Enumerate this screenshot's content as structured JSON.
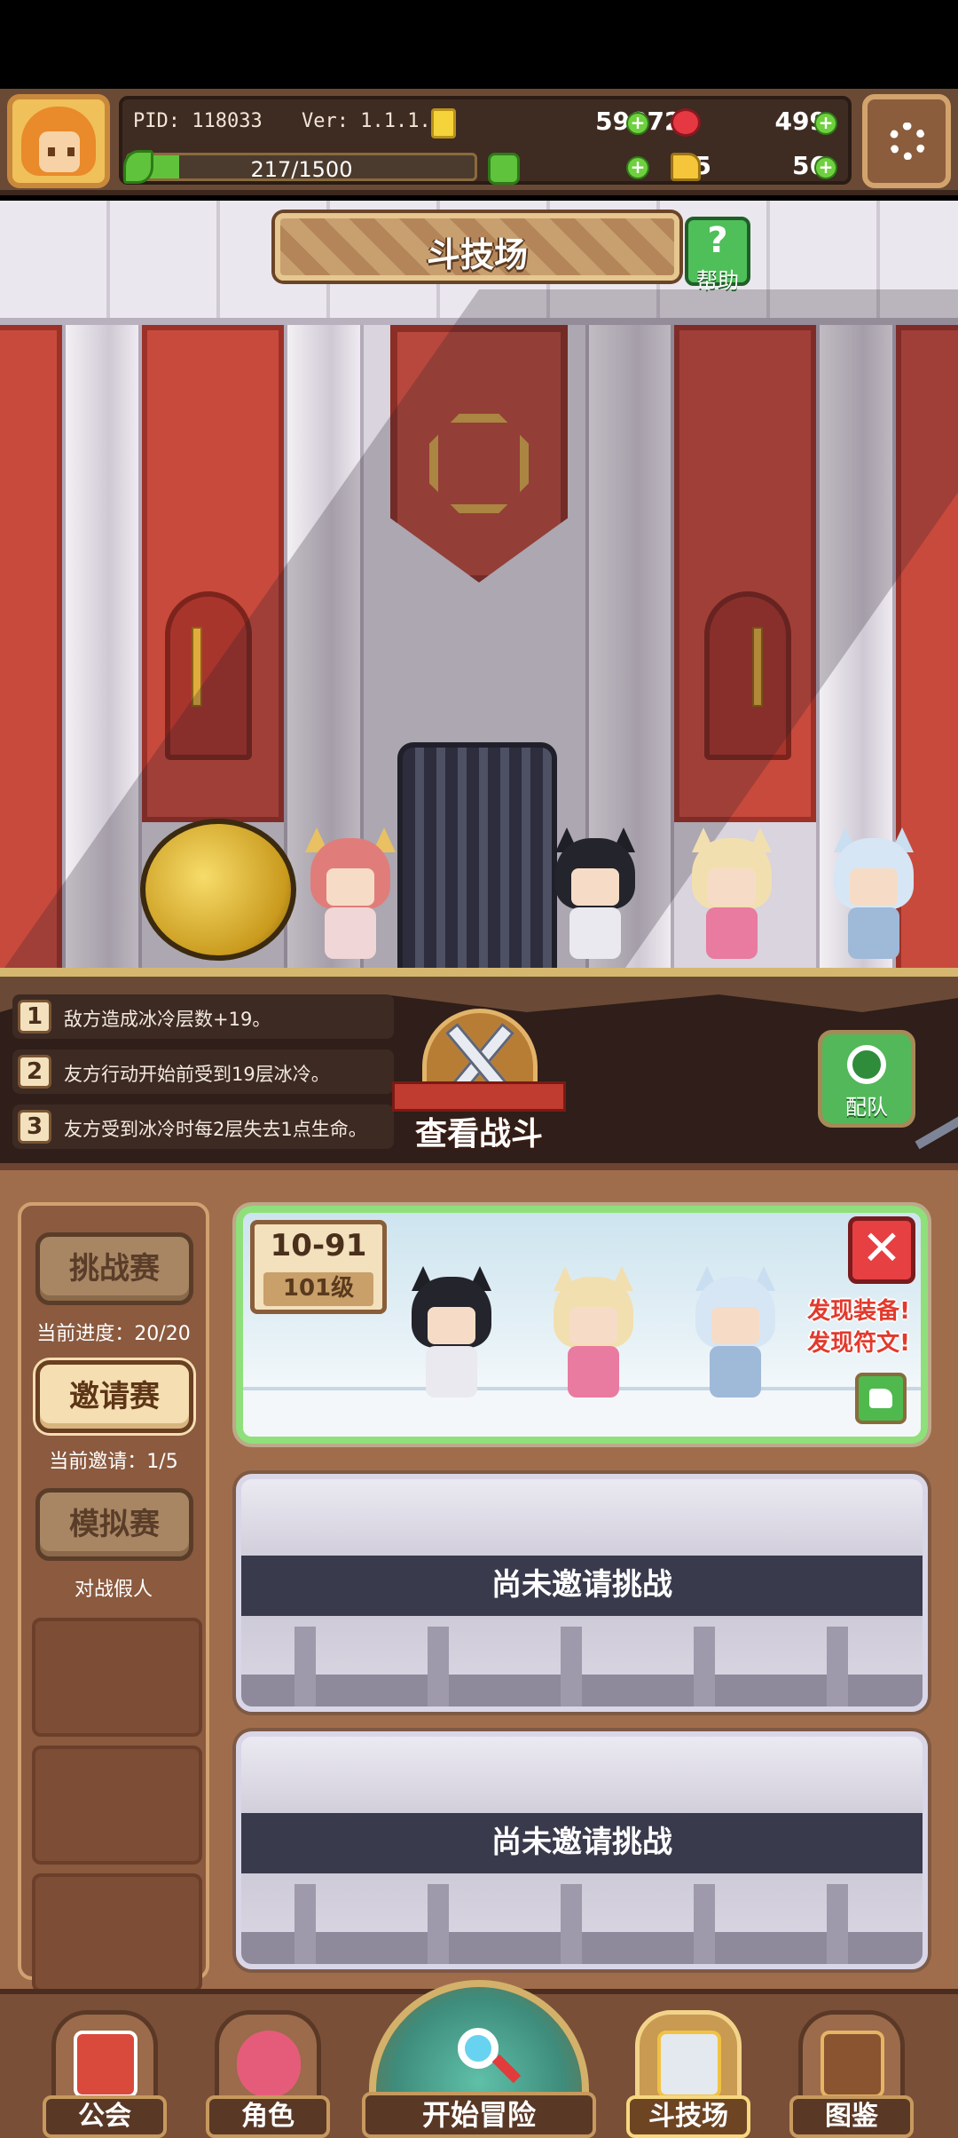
{
  "player": {
    "pid": "PID: 118033",
    "version": "Ver: 1.1.1.0",
    "gold": "598723",
    "rubies": "499",
    "exp_text": "217/1500",
    "exp_fraction": 0.145,
    "clovers": "5",
    "keys": "56"
  },
  "scene": {
    "title": "斗技场",
    "help_label": "帮助",
    "help_glyph": "?"
  },
  "rules": [
    {
      "num": "1",
      "text": "敌方造成冰冷层数+19。"
    },
    {
      "num": "2",
      "text": "友方行动开始前受到19层冰冷。"
    },
    {
      "num": "3",
      "text": "友方受到冰冷时每2层失去1点生命。"
    }
  ],
  "battle": {
    "label": "查看战斗"
  },
  "team": {
    "label": "配队"
  },
  "modes": [
    {
      "label": "挑战赛",
      "sub": "当前进度：20/20",
      "active": false
    },
    {
      "label": "邀请赛",
      "sub": "当前邀请：1/5",
      "active": true
    },
    {
      "label": "模拟赛",
      "sub": "对战假人",
      "active": false
    }
  ],
  "cards": {
    "active": {
      "score": "10-91",
      "grade": "101级",
      "close_glyph": "✕",
      "found_equipment": "发现装备!",
      "found_rune": "发现符文!"
    },
    "empty_text": "尚未邀请挑战"
  },
  "nav": {
    "guild": "公会",
    "character": "角色",
    "adventure": "开始冒险",
    "arena": "斗技场",
    "codex": "图鉴"
  },
  "colors": {
    "accent_green": "#60c23a",
    "danger_red": "#e64043",
    "panel_brown": "#a06d4c"
  }
}
